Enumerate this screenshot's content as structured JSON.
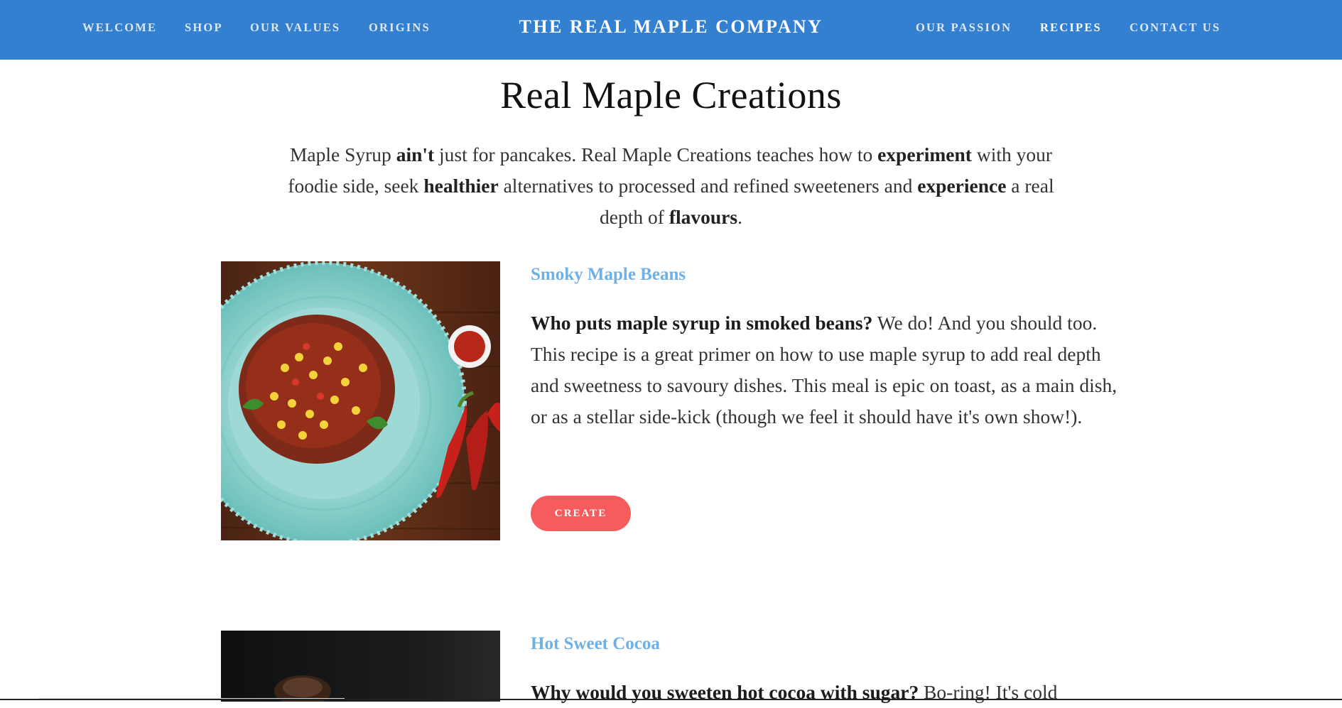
{
  "header": {
    "brand": "THE REAL MAPLE COMPANY",
    "nav_left": [
      "WELCOME",
      "SHOP",
      "OUR VALUES",
      "ORIGINS"
    ],
    "nav_right": [
      "OUR PASSION",
      "RECIPES",
      "CONTACT US"
    ],
    "active_item": "RECIPES",
    "background_color": "#337fd0"
  },
  "main": {
    "title": "Real Maple Creations",
    "intro": [
      {
        "text": "Maple Syrup ",
        "bold": false
      },
      {
        "text": "ain't",
        "bold": true
      },
      {
        "text": " just for pancakes.  Real Maple Creations teaches how to ",
        "bold": false
      },
      {
        "text": "experiment",
        "bold": true
      },
      {
        "text": " with your foodie side, seek ",
        "bold": false
      },
      {
        "text": "healthier",
        "bold": true
      },
      {
        "text": " alternatives to processed and refined sweeteners and ",
        "bold": false
      },
      {
        "text": "experience",
        "bold": true
      },
      {
        "text": " a real depth of ",
        "bold": false
      },
      {
        "text": "flavours",
        "bold": true
      },
      {
        "text": ".",
        "bold": false
      }
    ]
  },
  "recipes": [
    {
      "title": "Smoky Maple Beans",
      "lead": "Who puts maple syrup in smoked beans?",
      "body": " We do! And you should too. This recipe is a great primer on how to use maple syrup to add real depth and sweetness to savoury dishes. This meal is epic on toast, as a main dish, or as a stellar side-kick (though we feel it should have it's own show!).",
      "button": "CREATE",
      "image": "beans-plate-photo"
    },
    {
      "title": "Hot Sweet Cocoa",
      "lead": "Why would you sweeten hot cocoa with sugar?",
      "body": " Bo-ring! It's cold",
      "image": "cocoa-photo"
    }
  ],
  "colors": {
    "accent_title": "#6fb0e6",
    "button": "#f65b5e",
    "text": "#333333"
  }
}
